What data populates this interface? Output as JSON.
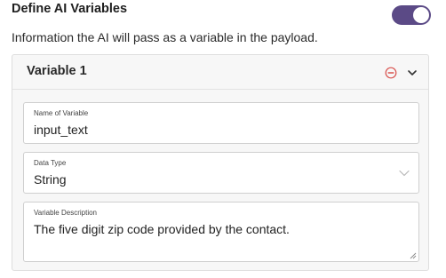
{
  "section": {
    "title": "Define AI Variables",
    "toggle_state": "on",
    "description": "Information the AI will pass as a variable in the payload."
  },
  "variable": {
    "header": "Variable 1",
    "fields": {
      "name": {
        "label": "Name of Variable",
        "value": "input_text"
      },
      "type": {
        "label": "Data Type",
        "value": "String"
      },
      "description": {
        "label": "Variable Description",
        "value": "The five digit zip code provided by the contact."
      }
    }
  },
  "colors": {
    "toggle_on": "#5b4a86",
    "remove_icon": "#d9534f"
  },
  "icons": {
    "remove": "minus-circle-icon",
    "collapse": "chevron-down-icon",
    "dropdown": "chevron-down-icon",
    "resize": "resize-handle-icon"
  }
}
